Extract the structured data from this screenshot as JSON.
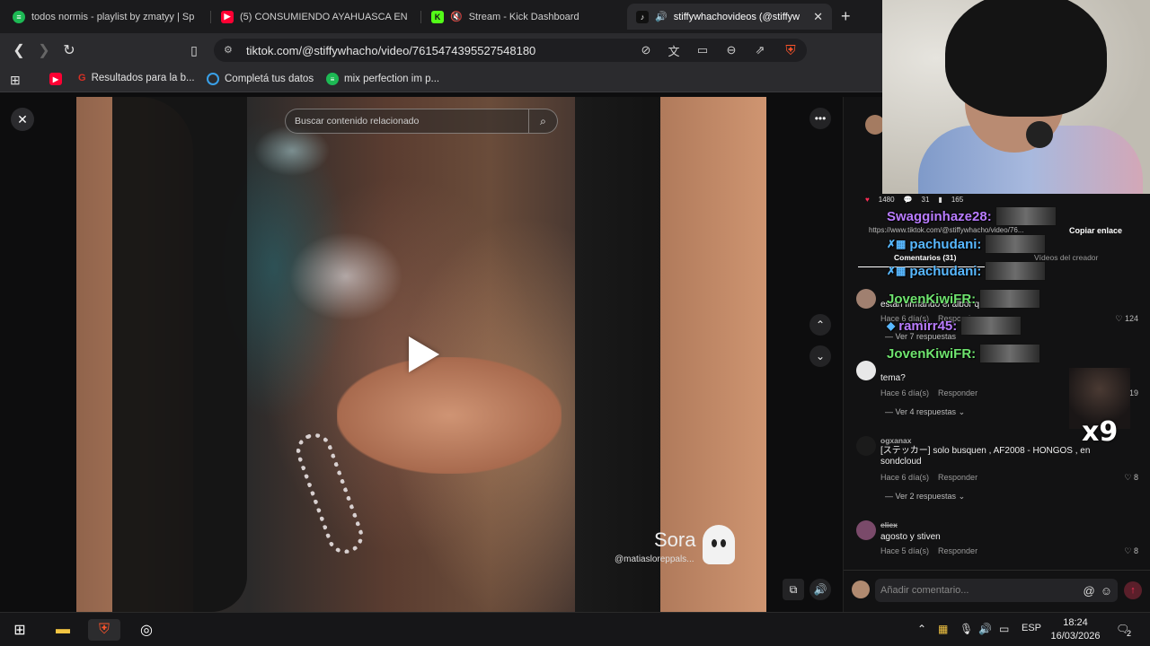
{
  "browser": {
    "tabs": [
      {
        "title": "todos normis - playlist by zmatyy | Sp",
        "icon": "spotify-icon",
        "color": "#1db954"
      },
      {
        "title": "(5) CONSUMIENDO AYAHUASCA EN",
        "icon": "youtube-icon",
        "color": "#ff0033"
      },
      {
        "title": "Stream - Kick Dashboard",
        "icon": "kick-icon",
        "color": "#53fc18"
      },
      {
        "title": "stiffywhachovideos (@stiffyw",
        "icon": "tiktok-icon",
        "color": "#ffffff",
        "active": true
      }
    ],
    "new_tab": "+",
    "url": "tiktok.com/@stiffywhacho/video/7615474395527548180",
    "bookmarks": [
      {
        "label": "Resultados para la b...",
        "icon": "google-icon",
        "color": "#d93025"
      },
      {
        "label": "Completá tus datos",
        "icon": "circle-icon",
        "color": "#39a0e8"
      },
      {
        "label": "mix perfection im p...",
        "icon": "spotify-icon",
        "color": "#1db954"
      }
    ]
  },
  "video": {
    "search_placeholder": "Buscar contenido relacionado",
    "watermark_name": "Sora",
    "watermark_handle": "@matiasloreppals..."
  },
  "stats": {
    "likes": "1480",
    "comments": "31",
    "saves": "165"
  },
  "share": {
    "link": "https://www.tiktok.com/@stiffywhacho/video/76...",
    "copy_label": "Copiar enlace"
  },
  "tabs_under": {
    "comments": "Comentarios (31)",
    "creator": "Vídeos del creador"
  },
  "comments": [
    {
      "user": "",
      "text": "estan firmando el albor q",
      "time": "Hace 6 día(s)",
      "reply": "Responder",
      "likes": "124",
      "replies": "Ver 7 respuestas"
    },
    {
      "user": "",
      "text": "tema?",
      "time": "Hace 6 día(s)",
      "reply": "Responder",
      "likes": "19",
      "replies": "Ver 4 respuestas"
    },
    {
      "user": "ogxanax",
      "text": "[ステッカー] solo busquen , AF2008 - HONGOS , en sondcloud",
      "time": "Hace 6 día(s)",
      "reply": "Responder",
      "likes": "8",
      "replies": "Ver 2 respuestas"
    },
    {
      "user": "eliex",
      "text": "agosto y stiven",
      "time": "Hace 5 día(s)",
      "reply": "Responder",
      "likes": "8",
      "replies": ""
    }
  ],
  "comment_input_placeholder": "Añadir comentario...",
  "chat": [
    {
      "user": "Swagginhaze28:",
      "color": "#b97cff"
    },
    {
      "user": "pachudani:",
      "color": "#58b8ff"
    },
    {
      "user": "pachudani:",
      "color": "#58b8ff"
    },
    {
      "user": "JovenKiwiFR:",
      "color": "#6ee36e"
    },
    {
      "user": "ramirr45:",
      "color": "#b97cff"
    },
    {
      "user": "JovenKiwiFR:",
      "color": "#6ee36e"
    }
  ],
  "big_emote_label": "x9",
  "taskbar": {
    "lang": "ESP",
    "time": "18:24",
    "date": "16/03/2026",
    "notif": "2"
  }
}
